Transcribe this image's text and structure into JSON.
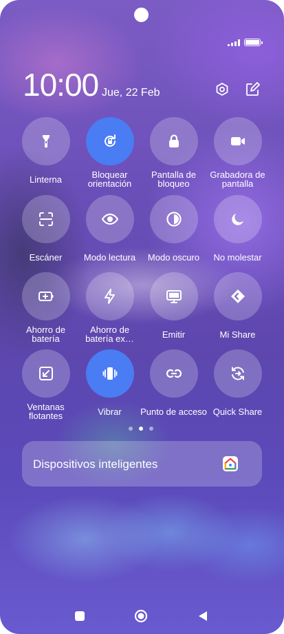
{
  "status": {
    "icons": [
      "signal-icon",
      "battery-icon"
    ]
  },
  "header": {
    "time": "10:00",
    "date": "Jue, 22 Feb",
    "icons": [
      "settings-icon",
      "edit-icon"
    ]
  },
  "tiles": [
    {
      "label": "Linterna",
      "icon": "flashlight-icon",
      "active": false
    },
    {
      "label": "Bloquear orientación",
      "icon": "rotation-lock-icon",
      "active": true
    },
    {
      "label": "Pantalla de bloqueo",
      "icon": "lock-icon",
      "active": false
    },
    {
      "label": "Grabadora de pantalla",
      "icon": "video-camera-icon",
      "active": false
    },
    {
      "label": "Escáner",
      "icon": "scanner-icon",
      "active": false
    },
    {
      "label": "Modo lectura",
      "icon": "eye-icon",
      "active": false
    },
    {
      "label": "Modo oscuro",
      "icon": "dark-mode-icon",
      "active": false
    },
    {
      "label": "No molestar",
      "icon": "moon-icon",
      "active": false
    },
    {
      "label": "Ahorro de batería",
      "icon": "battery-saver-icon",
      "active": false
    },
    {
      "label": "Ahorro de batería ex…",
      "icon": "lightning-icon",
      "active": false
    },
    {
      "label": "Emitir",
      "icon": "monitor-icon",
      "active": false
    },
    {
      "label": "Mi Share",
      "icon": "mi-share-icon",
      "active": false
    },
    {
      "label": "Ventanas flotantes",
      "icon": "floating-window-icon",
      "active": false
    },
    {
      "label": "Vibrar",
      "icon": "vibrate-icon",
      "active": true
    },
    {
      "label": "Punto de acceso",
      "icon": "hotspot-link-icon",
      "active": false
    },
    {
      "label": "Quick Share",
      "icon": "quick-share-icon",
      "active": false
    }
  ],
  "page_dots": {
    "count": 3,
    "active_index": 1
  },
  "devices": {
    "label": "Dispositivos inteligentes",
    "icon": "google-home-icon"
  },
  "nav": {
    "icons": [
      "recents-square-icon",
      "home-circle-icon",
      "back-triangle-icon"
    ]
  },
  "colors": {
    "active": "#4a7cf4",
    "tile": "rgba(255,255,255,0.22)"
  }
}
